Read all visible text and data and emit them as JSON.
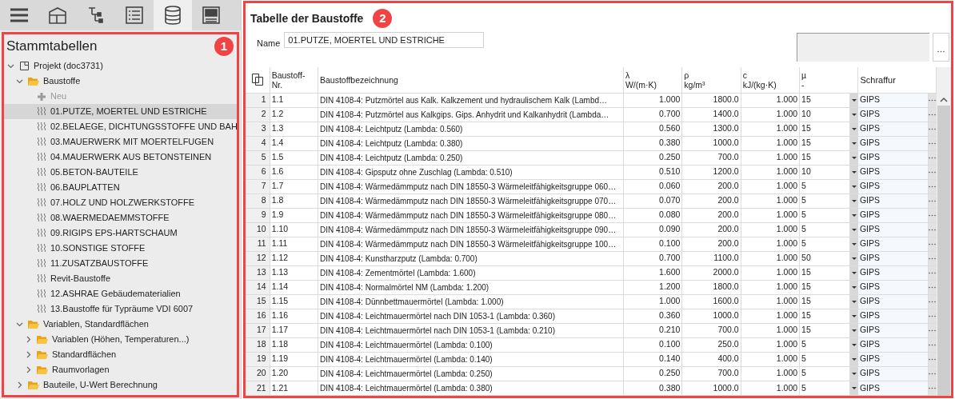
{
  "toolbar": [
    {
      "kind": "menu",
      "selected": false
    },
    {
      "kind": "building",
      "selected": false
    },
    {
      "kind": "hierarchy",
      "selected": false
    },
    {
      "kind": "list",
      "selected": false
    },
    {
      "kind": "database",
      "selected": true
    },
    {
      "kind": "panel",
      "selected": false
    }
  ],
  "sidebar": {
    "title": "Stammtabellen",
    "badge": "1",
    "tree": [
      {
        "kind": "project",
        "label": "Projekt (doc3731)",
        "expanded": true,
        "selected": false,
        "children": [
          {
            "kind": "folder",
            "label": "Baustoffe",
            "expanded": true,
            "selected": false,
            "children": [
              {
                "kind": "add",
                "label": "Neu",
                "selected": false
              },
              {
                "kind": "material",
                "label": "01.PUTZE, MOERTEL UND ESTRICHE",
                "selected": true
              },
              {
                "kind": "material",
                "label": "02.BELAEGE, DICHTUNGSSTOFFE UND BAH",
                "selected": false
              },
              {
                "kind": "material",
                "label": "03.MAUERWERK MIT MOERTELFUGEN",
                "selected": false
              },
              {
                "kind": "material",
                "label": "04.MAUERWERK AUS BETONSTEINEN",
                "selected": false
              },
              {
                "kind": "material",
                "label": "05.BETON-BAUTEILE",
                "selected": false
              },
              {
                "kind": "material",
                "label": "06.BAUPLATTEN",
                "selected": false
              },
              {
                "kind": "material",
                "label": "07.HOLZ UND HOLZWERKSTOFFE",
                "selected": false
              },
              {
                "kind": "material",
                "label": "08.WAERMEDAEMMSTOFFE",
                "selected": false
              },
              {
                "kind": "material",
                "label": "09.RIGIPS EPS-HARTSCHAUM",
                "selected": false
              },
              {
                "kind": "material",
                "label": "10.SONSTIGE STOFFE",
                "selected": false
              },
              {
                "kind": "material",
                "label": "11.ZUSATZBAUSTOFFE",
                "selected": false
              },
              {
                "kind": "material",
                "label": "Revit-Baustoffe",
                "selected": false
              },
              {
                "kind": "material",
                "label": "12.ASHRAE Gebäudematerialien",
                "selected": false
              },
              {
                "kind": "material",
                "label": "13.Baustoffe für Typräume VDI 6007",
                "selected": false
              }
            ]
          },
          {
            "kind": "folder",
            "label": "Variablen, Standardflächen",
            "expanded": true,
            "selected": false,
            "children": [
              {
                "kind": "folder",
                "label": "Variablen (Höhen, Temperaturen...)",
                "expanded": false,
                "selected": false
              },
              {
                "kind": "folder",
                "label": "Standardflächen",
                "expanded": false,
                "selected": false
              },
              {
                "kind": "folder",
                "label": "Raumvorlagen",
                "expanded": false,
                "selected": false
              }
            ]
          },
          {
            "kind": "folder",
            "label": "Bauteile, U-Wert Berechnung",
            "expanded": false,
            "selected": false
          }
        ]
      }
    ]
  },
  "main": {
    "title": "Tabelle der Baustoffe",
    "badge": "2",
    "name_label": "Name",
    "name_value": "01.PUTZE, MOERTEL UND ESTRICHE",
    "table": {
      "columns": [
        {
          "symbol": "Baustoff-",
          "unit": "Nr."
        },
        {
          "symbol": "Baustoffbezeichnung"
        },
        {
          "symbol": "λ",
          "unit": "W/(m·K)"
        },
        {
          "symbol": "ρ",
          "unit": "kg/m³"
        },
        {
          "symbol": "c",
          "unit": "kJ/(kg·K)"
        },
        {
          "symbol": "µ",
          "unit": "-"
        },
        {
          "symbol": "Schraffur"
        }
      ],
      "rows": [
        {
          "index": "1",
          "cells": [
            "1.1",
            "DIN 4108-4: Putzmörtel aus Kalk. Kalkzement und hydraulischem Kalk (Lambd…",
            "1.000",
            "1800.0",
            "1.000",
            "15",
            "GIPS"
          ]
        },
        {
          "index": "2",
          "cells": [
            "1.2",
            "DIN 4108-4: Putzmörtel aus Kalkgips. Gips. Anhydrit und Kalkanhydrit (Lambda…",
            "0.700",
            "1400.0",
            "1.000",
            "10",
            "GIPS"
          ]
        },
        {
          "index": "3",
          "cells": [
            "1.3",
            "DIN 4108-4: Leichtputz (Lambda: 0.560)",
            "0.560",
            "1300.0",
            "1.000",
            "15",
            "GIPS"
          ]
        },
        {
          "index": "4",
          "cells": [
            "1.4",
            "DIN 4108-4: Leichtputz (Lambda: 0.380)",
            "0.380",
            "1000.0",
            "1.000",
            "15",
            "GIPS"
          ]
        },
        {
          "index": "5",
          "cells": [
            "1.5",
            "DIN 4108-4: Leichtputz (Lambda: 0.250)",
            "0.250",
            "700.0",
            "1.000",
            "15",
            "GIPS"
          ]
        },
        {
          "index": "6",
          "cells": [
            "1.6",
            "DIN 4108-4: Gipsputz ohne Zuschlag (Lambda: 0.510)",
            "0.510",
            "1200.0",
            "1.000",
            "10",
            "GIPS"
          ]
        },
        {
          "index": "7",
          "cells": [
            "1.7",
            "DIN 4108-4: Wärmedämmputz nach DIN 18550-3 Wärmeleitfähigkeitsgruppe 060…",
            "0.060",
            "200.0",
            "1.000",
            "5",
            "GIPS"
          ]
        },
        {
          "index": "8",
          "cells": [
            "1.8",
            "DIN 4108-4: Wärmedämmputz nach DIN 18550-3 Wärmeleitfähigkeitsgruppe 070…",
            "0.070",
            "200.0",
            "1.000",
            "5",
            "GIPS"
          ]
        },
        {
          "index": "9",
          "cells": [
            "1.9",
            "DIN 4108-4: Wärmedämmputz nach DIN 18550-3 Wärmeleitfähigkeitsgruppe 080…",
            "0.080",
            "200.0",
            "1.000",
            "5",
            "GIPS"
          ]
        },
        {
          "index": "10",
          "cells": [
            "1.10",
            "DIN 4108-4: Wärmedämmputz nach DIN 18550-3 Wärmeleitfähigkeitsgruppe 090…",
            "0.090",
            "200.0",
            "1.000",
            "5",
            "GIPS"
          ]
        },
        {
          "index": "11",
          "cells": [
            "1.11",
            "DIN 4108-4: Wärmedämmputz nach DIN 18550-3 Wärmeleitfähigkeitsgruppe 100…",
            "0.100",
            "200.0",
            "1.000",
            "5",
            "GIPS"
          ]
        },
        {
          "index": "12",
          "cells": [
            "1.12",
            "DIN 4108-4: Kunstharzputz (Lambda: 0.700)",
            "0.700",
            "1100.0",
            "1.000",
            "50",
            "GIPS"
          ]
        },
        {
          "index": "13",
          "cells": [
            "1.13",
            "DIN 4108-4: Zementmörtel (Lambda: 1.600)",
            "1.600",
            "2000.0",
            "1.000",
            "15",
            "GIPS"
          ]
        },
        {
          "index": "14",
          "cells": [
            "1.14",
            "DIN 4108-4: Normalmörtel NM (Lambda: 1.200)",
            "1.200",
            "1800.0",
            "1.000",
            "15",
            "GIPS"
          ]
        },
        {
          "index": "15",
          "cells": [
            "1.15",
            "DIN 4108-4: Dünnbettmauermörtel (Lambda: 1.000)",
            "1.000",
            "1600.0",
            "1.000",
            "15",
            "GIPS"
          ]
        },
        {
          "index": "16",
          "cells": [
            "1.16",
            "DIN 4108-4: Leichtmauermörtel nach DIN 1053-1 (Lambda: 0.360)",
            "0.360",
            "1000.0",
            "1.000",
            "15",
            "GIPS"
          ]
        },
        {
          "index": "17",
          "cells": [
            "1.17",
            "DIN 4108-4: Leichtmauermörtel nach DIN 1053-1 (Lambda: 0.210)",
            "0.210",
            "700.0",
            "1.000",
            "15",
            "GIPS"
          ]
        },
        {
          "index": "18",
          "cells": [
            "1.18",
            "DIN 4108-4: Leichtmauermörtel (Lambda: 0.100)",
            "0.100",
            "250.0",
            "1.000",
            "5",
            "GIPS"
          ]
        },
        {
          "index": "19",
          "cells": [
            "1.19",
            "DIN 4108-4: Leichtmauermörtel (Lambda: 0.140)",
            "0.140",
            "400.0",
            "1.000",
            "5",
            "GIPS"
          ]
        },
        {
          "index": "20",
          "cells": [
            "1.20",
            "DIN 4108-4: Leichtmauermörtel (Lambda: 0.250)",
            "0.250",
            "700.0",
            "1.000",
            "5",
            "GIPS"
          ]
        },
        {
          "index": "21",
          "cells": [
            "1.21",
            "DIN 4108-4: Leichtmauermörtel (Lambda: 0.380)",
            "0.380",
            "1000.0",
            "1.000",
            "5",
            "GIPS"
          ]
        }
      ]
    }
  }
}
